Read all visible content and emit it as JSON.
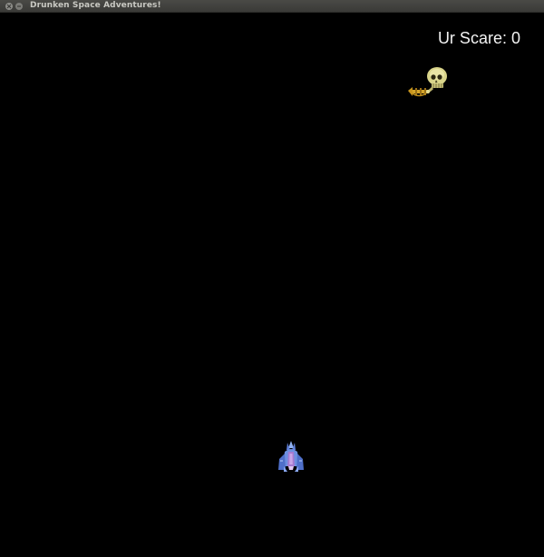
{
  "window": {
    "title": "Drunken Space Adventures!",
    "close_icon": "close-icon",
    "minimize_icon": "minimize-icon"
  },
  "hud": {
    "score_label": "Ur Scare:",
    "score_value": "0"
  },
  "sprites": {
    "enemy": "skull-trumpet-sprite",
    "player": "spaceship-sprite"
  },
  "colors": {
    "background": "#000000",
    "text": "#f2f2f2",
    "titlebar": "#3e3e3b"
  }
}
